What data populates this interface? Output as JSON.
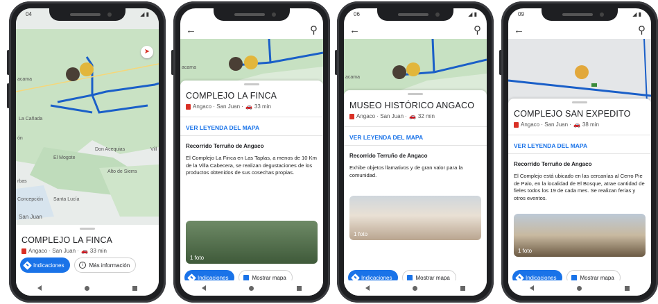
{
  "screens": [
    {
      "status_time": "04",
      "title": "COMPLEJO LA FINCA",
      "location": "Angaco · San Juan · ",
      "duration": "33 min",
      "directions_label": "Indicaciones",
      "secondary_label": "Más información",
      "map_labels": [
        "acama",
        "La Cañada",
        "El Mogote",
        "Don Acequias",
        "Alto de Sierra",
        "Concepción",
        "Santa Lucía",
        "San Juan",
        "Vill",
        "ón",
        "rbas"
      ]
    },
    {
      "status_time": "",
      "title": "COMPLEJO LA FINCA",
      "location": "Angaco · San Juan · ",
      "duration": "33 min",
      "legend_link": "VER LEYENDA DEL MAPA",
      "section_title": "Recorrido Terruño de Angaco",
      "description": "El Complejo La Finca en Las Taplas, a menos de 10 Km de la Villa Cabecera, se realizan  degustaciones de los productos obtenidos de sus cosechas propias.",
      "photo_count": "1 foto",
      "directions_label": "Indicaciones",
      "secondary_label": "Mostrar mapa",
      "map_labels": [
        "acama"
      ]
    },
    {
      "status_time": "06",
      "title": "MUSEO HISTÓRICO ANGACO",
      "location": "Angaco · San Juan · ",
      "duration": "32 min",
      "legend_link": "VER LEYENDA DEL MAPA",
      "section_title": "Recorrido Terruño de Angaco",
      "description": "Exhibe objetos llamativos y de gran valor para la comunidad.",
      "photo_count": "1 foto",
      "directions_label": "Indicaciones",
      "secondary_label": "Mostrar mapa",
      "map_labels": [
        "acama"
      ]
    },
    {
      "status_time": "09",
      "title": "COMPLEJO SAN EXPEDITO",
      "location": "Angaco · San Juan · ",
      "duration": "38 min",
      "legend_link": "VER LEYENDA DEL MAPA",
      "section_title": "Recorrido Terruño de Angaco",
      "description": "El Complejo está ubicado en las cercanías al Cerro Pie de Palo, en la localidad de El Bosque, atrae cantidad de fieles todos los  19 de cada mes. Se realizan ferias y otros eventos.",
      "photo_count": "1 foto",
      "directions_label": "Indicaciones",
      "secondary_label": "Mostrar mapa",
      "map_labels": []
    }
  ],
  "icons": {
    "back": "arrow-left-icon",
    "search": "search-icon",
    "directions": "directions-icon",
    "map": "map-icon",
    "info": "info-icon",
    "compass": "compass-icon",
    "car": "car-icon"
  },
  "colors": {
    "accent": "#1a73e8",
    "map_green": "#c7e1c2",
    "route_blue": "#1a5fc8",
    "pin_red": "#d93025"
  }
}
